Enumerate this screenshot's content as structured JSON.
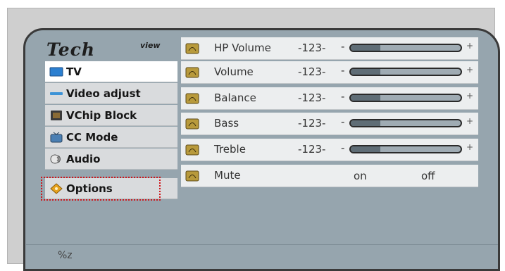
{
  "logo": {
    "brand": "Tech",
    "suffix": "view"
  },
  "sidebar": {
    "items": [
      {
        "label": "TV",
        "icon": "tv-icon",
        "active": true
      },
      {
        "label": "Video adjust",
        "icon": "video-adjust-icon",
        "active": false
      },
      {
        "label": "VChip Block",
        "icon": "vchip-block-icon",
        "active": false
      },
      {
        "label": "CC Mode",
        "icon": "cc-mode-icon",
        "active": false
      },
      {
        "label": "Audio",
        "icon": "audio-icon",
        "active": false
      },
      {
        "label": "Options",
        "icon": "options-icon",
        "active": false,
        "highlighted": true
      }
    ]
  },
  "audio_settings": {
    "rows": [
      {
        "name": "HP Volume",
        "value": "-123-",
        "level": 0.27,
        "minus": "-",
        "plus": "+"
      },
      {
        "name": "Volume",
        "value": "-123-",
        "level": 0.27,
        "minus": "-",
        "plus": "+"
      },
      {
        "name": "Balance",
        "value": "-123-",
        "level": 0.27,
        "minus": "-",
        "plus": "+"
      },
      {
        "name": "Bass",
        "value": "-123-",
        "level": 0.27,
        "minus": "-",
        "plus": "+"
      },
      {
        "name": "Treble",
        "value": "-123-",
        "level": 0.27,
        "minus": "-",
        "plus": "+"
      }
    ],
    "mute": {
      "name": "Mute",
      "on_label": "on",
      "off_label": "off"
    }
  },
  "status": {
    "text": "%z"
  },
  "colors": {
    "selection_border": "#d0151a",
    "panel": "#96a5ae",
    "row": "#eceeef",
    "active_item": "#ffffff"
  }
}
